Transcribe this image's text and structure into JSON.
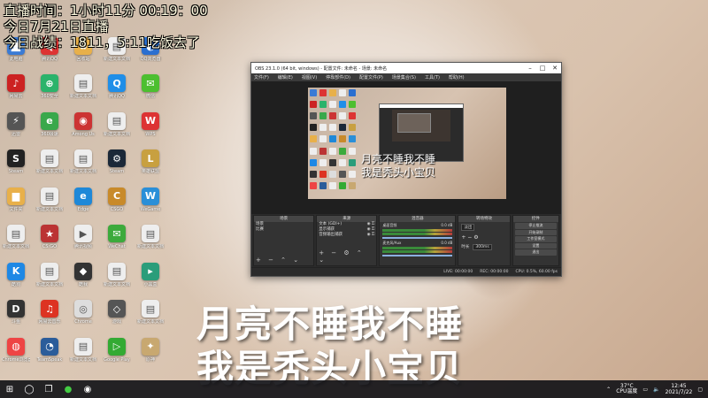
{
  "overlay": {
    "line1": "直播时间：1小时11分 00:19：00",
    "line2": "今日7月21日直播",
    "line3": "今日战绩：1811，5:11吃饭去了"
  },
  "desktop_icons": [
    {
      "label": "此电脑",
      "color": "#3a7bd5",
      "glyph": "🖥"
    },
    {
      "label": "腾讯QQ",
      "color": "#d33",
      "glyph": "Q"
    },
    {
      "label": "回收站",
      "color": "#e8b04a",
      "glyph": "♻"
    },
    {
      "label": "新建文本文档",
      "color": "#eee",
      "glyph": "▤"
    },
    {
      "label": "QQ浏览器",
      "color": "#2a6fd0",
      "glyph": "◐"
    },
    {
      "label": "网易云",
      "color": "#c22",
      "glyph": "♪"
    },
    {
      "label": "360安全",
      "color": "#2bb36b",
      "glyph": "⊕"
    },
    {
      "label": "新建文本文档",
      "color": "#eee",
      "glyph": "▤"
    },
    {
      "label": "腾讯QQ",
      "color": "#1f8ee8",
      "glyph": "Q"
    },
    {
      "label": "微信",
      "color": "#4cbf30",
      "glyph": "✉"
    },
    {
      "label": "迅雷",
      "color": "#555",
      "glyph": "⚡"
    },
    {
      "label": "360极速",
      "color": "#39a84b",
      "glyph": "e"
    },
    {
      "label": "Among Us",
      "color": "#c33",
      "glyph": "◉"
    },
    {
      "label": "新建文本文档",
      "color": "#eee",
      "glyph": "▤"
    },
    {
      "label": "WPS",
      "color": "#d33",
      "glyph": "W"
    },
    {
      "label": "Steam",
      "color": "#222",
      "glyph": "S"
    },
    {
      "label": "新建文本文档",
      "color": "#eee",
      "glyph": "▤"
    },
    {
      "label": "新建文本文档",
      "color": "#eee",
      "glyph": "▤"
    },
    {
      "label": "Steam",
      "color": "#1b2838",
      "glyph": "⚙"
    },
    {
      "label": "英雄联盟",
      "color": "#c8a040",
      "glyph": "L"
    },
    {
      "label": "文件夹",
      "color": "#e8b04a",
      "glyph": "▆"
    },
    {
      "label": "新建文本文档",
      "color": "#eee",
      "glyph": "▤"
    },
    {
      "label": "Edge",
      "color": "#1e88d8",
      "glyph": "e"
    },
    {
      "label": "CSGO",
      "color": "#c88a2a",
      "glyph": "C"
    },
    {
      "label": "WeGame",
      "color": "#2a8fd8",
      "glyph": "W"
    },
    {
      "label": "新建文本文档",
      "color": "#eee",
      "glyph": "▤"
    },
    {
      "label": "CS:GO",
      "color": "#b33",
      "glyph": "★"
    },
    {
      "label": "腾讯视频",
      "color": "#eee",
      "glyph": "▶"
    },
    {
      "label": "WeChat",
      "color": "#3caa3c",
      "glyph": "✉"
    },
    {
      "label": "新建文本文档",
      "color": "#eee",
      "glyph": "▤"
    },
    {
      "label": "酷狗",
      "color": "#1e88e5",
      "glyph": "K"
    },
    {
      "label": "新建文本文档",
      "color": "#eee",
      "glyph": "▤"
    },
    {
      "label": "酷我",
      "color": "#333",
      "glyph": "◆"
    },
    {
      "label": "新建文本文档",
      "color": "#eee",
      "glyph": "▤"
    },
    {
      "label": "小黑盒",
      "color": "#2a9d7a",
      "glyph": "▸"
    },
    {
      "label": "斗鱼",
      "color": "#333",
      "glyph": "D"
    },
    {
      "label": "网易云音乐",
      "color": "#d32",
      "glyph": "♫"
    },
    {
      "label": "Chrome",
      "color": "#ddd",
      "glyph": "◎"
    },
    {
      "label": "游戏",
      "color": "#555",
      "glyph": "◇"
    },
    {
      "label": "新建文本文档",
      "color": "#eee",
      "glyph": "▤"
    },
    {
      "label": "Chrome浏览器",
      "color": "#e44",
      "glyph": "◍"
    },
    {
      "label": "TeamSpeak",
      "color": "#2a5c9a",
      "glyph": "◔"
    },
    {
      "label": "新建文本文档",
      "color": "#eee",
      "glyph": "▤"
    },
    {
      "label": "Google Play",
      "color": "#3a3",
      "glyph": "▷"
    },
    {
      "label": "原神",
      "color": "#c8a870",
      "glyph": "✦"
    }
  ],
  "obs": {
    "title": "OBS 23.1.0 (64 bit, windows) - 配置文件: 未命名 - 场景: 未命名",
    "menu": [
      "文件(F)",
      "编辑(E)",
      "视图(V)",
      "停靠部件(D)",
      "配置文件(P)",
      "场景集合(S)",
      "工具(T)",
      "帮助(H)"
    ],
    "preview_caption_1": "月亮不睡我不睡",
    "preview_caption_2": "我是秃头小宝贝",
    "scenes_header": "场景",
    "scenes": [
      "场景",
      "比赛"
    ],
    "sources_header": "来源",
    "sources": [
      "文本 (GDI+)",
      "显示捕获",
      "音频输出捕获"
    ],
    "mixer_header": "混音器",
    "mixer": [
      {
        "name": "桌面音频",
        "db": "0.0 dB"
      },
      {
        "name": "麦克风/Aux",
        "db": "0.0 dB"
      }
    ],
    "transitions_header": "转场特效",
    "transition_type": "淡出",
    "duration_label": "时长",
    "duration_value": "300ms",
    "controls_header": "控件",
    "controls": [
      "停止推流",
      "开始录制",
      "工作室模式",
      "设置",
      "退出"
    ],
    "status_live": "LIVE: 00:00:00",
    "status_rec": "REC: 00:00:00",
    "status_cpu": "CPU: 0.5%, 60.00 fps"
  },
  "big_caption": {
    "line1": "月亮不睡我不睡",
    "line2": "我是秃头小宝贝"
  },
  "taskbar": {
    "start_glyph": "⊞",
    "cpu_temp": "37°C",
    "cpu_label": "CPU温度",
    "time": "12:45",
    "date": "2021/7/22"
  }
}
